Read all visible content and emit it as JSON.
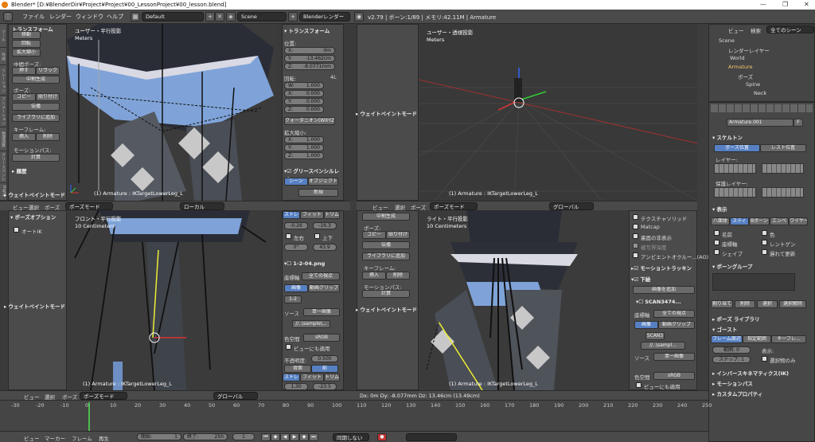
{
  "window": {
    "title": "Blender* [D:¥BlenderDir¥Project¥Project¥00_LessonProject¥00_lesson.blend]",
    "min": "—",
    "max": "❐",
    "close": "✕"
  },
  "infobar": {
    "menus": [
      "ファイル",
      "レンダー",
      "ウィンドウ",
      "ヘルプ"
    ],
    "layout": "Default",
    "scene": "Scene",
    "engine": "Blenderレンダー",
    "status": "v2.79 | ボーン:1/89 | メモリ:42.11M | Armature"
  },
  "toolshelf_top": {
    "tabs": [
      "ツール",
      "作成",
      "リレーション",
      "アニメーション",
      "物理演算",
      "グリースペンシル",
      "Rigify"
    ],
    "section": "トランスフォーム",
    "transform": [
      "移動",
      "回転",
      "拡大縮小"
    ],
    "pose_label": "中間ポーズ:",
    "push": "押す",
    "relax": "リラック",
    "breakdown": "中割生成",
    "pose": "ポーズ:",
    "copy": "コピー",
    "paste": "貼り付け",
    "propagate": "伝播",
    "library": "ライブラリに追加",
    "keyframe": "キーフレーム:",
    "insert": "挿入",
    "delete": "削除",
    "motionpath": "モーションパス:",
    "calc": "計算",
    "history": "履歴",
    "weightmode": "ウェイトペイントモード"
  },
  "toolshelf_bottom": {
    "section": "ボーズオプション",
    "autoik": "オートIK",
    "weightmode": "ウェイトペイントモード"
  },
  "vp_topleft": {
    "view": "ユーザー・平行投影",
    "units": "Meters",
    "selected": "(1) Armature : IKTargetLowerLeg_L"
  },
  "vp_topright": {
    "view": "ユーザー・透視投影",
    "units": "Meters",
    "selected": "(1) Armature : IKTargetLowerLeg_L"
  },
  "vp_botleft": {
    "view": "フロント・平行投影",
    "units": "10 Centimeters",
    "selected": "(1) Armature : IKTargetLowerLeg_L"
  },
  "vp_botright": {
    "view": "ライト・平行投影",
    "units": "10 Centimeters",
    "selected": "(1) Armature : IKTargetLowerLeg_L",
    "status": "Dx: 0m   Dy: -8.077mm   Dz: 13.46cm (13.49cm)"
  },
  "npanel_top": {
    "section": "トランスフォーム",
    "location": "位置:",
    "x": "X:",
    "xv": "0m",
    "y": "Y:",
    "yv": "-13.462cm",
    "z": "Z:",
    "zv": "-8.0771mm",
    "rotation": "回転:",
    "rotmode": "4L",
    "w": "W:",
    "wv": "1.000",
    "rx": "X:",
    "rxv": "0.000",
    "ry": "Y:",
    "ryv": "0.000",
    "rz": "Z:",
    "rzv": "0.000",
    "quat": "クォータニオン(WXYZ)",
    "scale": "拡大縮小:",
    "sx": "X:",
    "sxv": "1.000",
    "sy": "Y:",
    "syv": "1.000",
    "sz": "Z:",
    "szv": "1.000",
    "gp": "グリースペンシルレイ",
    "scene": "シーン",
    "object": "オブジェクト",
    "new": "新規"
  },
  "npanel_bottom": {
    "stretch": "ストレ",
    "fit": "フィット",
    "trim": "トリム",
    "v1": "-0.26",
    "v2": "-16.3",
    "left": "左右",
    "updown": "上下",
    "v3": "0°",
    "v4": "43.9",
    "image": "1-2-04.png",
    "coord": "座標軸",
    "allviews": "全ての視点",
    "img": "画像",
    "movie": "動画クリップ",
    "n12": "1-2",
    "source": "ソース",
    "single": "単一画像",
    "path": "//..\\sample\\...",
    "colorspace": "色空間",
    "srgb": "sRGB",
    "viewer": "ビューにも適用",
    "opacity": "不透明度:",
    "opv": "0.500",
    "back": "背面",
    "front": "前",
    "stretch2": "ストレ",
    "fit2": "フィット",
    "trim2": "トリム",
    "v5": "1.30",
    "v6": "-23.5"
  },
  "toolshelf_mid": {
    "breakdown": "中割生成",
    "pose": "ポーズ:",
    "copy": "コピー",
    "paste": "貼り付け",
    "propagate": "伝播",
    "library": "ライブラリに追加",
    "keyframe": "キーフレーム:",
    "insert": "挿入",
    "delete": "削除",
    "motionpath": "モーションパス:",
    "calc": "計算",
    "weightmode": "ウェイトペイントモード"
  },
  "npanel_right": {
    "items": [
      "テクスチャソリッド",
      "Matcap",
      "裏面の非表示",
      "被写界深度",
      "アンビエントオクルー...(AO)"
    ],
    "motiontrack": "モーショントラッキン",
    "bg": "下絵",
    "addimg": "画像を追加",
    "scan": "SCAN3474...",
    "coord": "座標軸",
    "allviews": "全ての視点",
    "img": "画像",
    "movie": "動画クリップ",
    "scan3": "SCAN3",
    "path": "//..\\sampl...",
    "source": "ソース",
    "single": "単一画像",
    "colorspace": "色空間",
    "srgb": "sRGB",
    "viewer": "ビューにも適用"
  },
  "vpheader": {
    "view": "ビュー",
    "select": "選択",
    "pose": "ポーズ",
    "mode": "ポーズモード",
    "local": "ローカル",
    "global": "グローバル"
  },
  "outliner": {
    "view": "ビュー",
    "search": "検索",
    "scenes": "全てのシーン",
    "items": [
      "Scene",
      "レンダーレイヤー",
      "World",
      "Armature",
      "ポーズ",
      "Spine",
      "Neck"
    ]
  },
  "props": {
    "name": "Armature.001",
    "f": "F",
    "skeleton": "スケルトン",
    "poseposition": "ポーズ位置",
    "restposition": "レスト位置",
    "layers": "レイヤー:",
    "protected": "保護レイヤー:",
    "display": "表示",
    "tabs": [
      "八面体",
      "スティ",
      "Bボーン",
      "エンベ",
      "ワイヤー"
    ],
    "names": "名前",
    "color": "色",
    "axes": "座標軸",
    "xray": "レントゲン",
    "shape": "シェイプ",
    "delay": "遅れて更新",
    "bonegroups": "ボーングループ",
    "assign": "割り当て",
    "remove": "削除",
    "select": "選択",
    "deselect": "選択解除",
    "poselib": "ポーズ ライブラリ",
    "ghost": "ゴースト",
    "around": "フレーム周辺",
    "range": "指定範囲",
    "keyframes": "キーフレ...",
    "rangelbl": "範囲:",
    "rangev": "0",
    "display2": "表示:",
    "step": "ステップ:",
    "stepv": "1",
    "selonly": "選択物のみ",
    "ik": "インバースキネマティクス(IK)",
    "motionpath": "モーションパス",
    "custom": "カスタムプロパティ"
  },
  "timeline": {
    "ticks": [
      "-30",
      "-20",
      "-10",
      "0",
      "10",
      "20",
      "30",
      "40",
      "50",
      "60",
      "70",
      "80",
      "90",
      "100",
      "110",
      "120",
      "130",
      "140",
      "150",
      "160",
      "170",
      "180",
      "190",
      "200",
      "210",
      "220",
      "230",
      "240",
      "250"
    ],
    "view": "ビュー",
    "marker": "マーカー",
    "frame": "フレーム",
    "play": "再生",
    "start": "開始:",
    "startv": "1",
    "end": "終了:",
    "endv": "250",
    "current": "1",
    "sync": "同期しない"
  }
}
